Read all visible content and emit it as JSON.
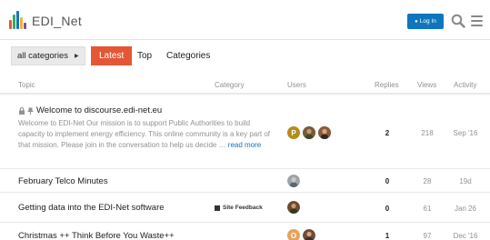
{
  "header": {
    "logo_text": "EDI_Net",
    "login_label": "Log In",
    "icons": [
      "edi-net-logo",
      "person-icon",
      "search-icon",
      "hamburger-menu-icon"
    ]
  },
  "nav": {
    "category_dropdown": "all categories",
    "items": [
      {
        "label": "Latest",
        "active": true
      },
      {
        "label": "Top",
        "active": false
      },
      {
        "label": "Categories",
        "active": false
      }
    ]
  },
  "table": {
    "headers": {
      "topic": "Topic",
      "category": "Category",
      "users": "Users",
      "replies": "Replies",
      "views": "Views",
      "activity": "Activity"
    },
    "rows": [
      {
        "title": "Welcome to discourse.edi-net.eu",
        "icons": [
          "lock-icon",
          "pin-icon"
        ],
        "excerpt": "Welcome to EDI-Net Our mission is to support Public Authorities to build capacity to implement energy efficiency. This online community is a key part of that mission. Please join in the conversation to help us decide … ",
        "read_more": "read more",
        "category": "",
        "avatars": [
          {
            "letter": "P",
            "color": "#b58b1a"
          },
          {
            "letter": "",
            "color": "#6b4a2e"
          },
          {
            "letter": "",
            "color": "#7a4b2a"
          }
        ],
        "replies": "2",
        "views": "218",
        "activity": "Sep '16"
      },
      {
        "title": "February Telco Minutes",
        "category": "",
        "avatars": [
          {
            "letter": "",
            "color": "#8f9aa6"
          }
        ],
        "replies": "0",
        "views": "28",
        "activity": "19d"
      },
      {
        "title": "Getting data into the EDI-Net software",
        "category": "Site Feedback",
        "avatars": [
          {
            "letter": "",
            "color": "#6b4a2e"
          }
        ],
        "replies": "0",
        "views": "61",
        "activity": "Jan 26"
      },
      {
        "title": "Christmas ++ Think Before You Waste++",
        "category": "",
        "avatars": [
          {
            "letter": "O",
            "color": "#e8a25c"
          },
          {
            "letter": "",
            "color": "#6e4c3a"
          }
        ],
        "replies": "1",
        "views": "97",
        "activity": "Dec '16"
      }
    ]
  },
  "colors": {
    "accent": "#e45735",
    "login_blue": "#0e76bd",
    "muted_text": "#919191"
  }
}
